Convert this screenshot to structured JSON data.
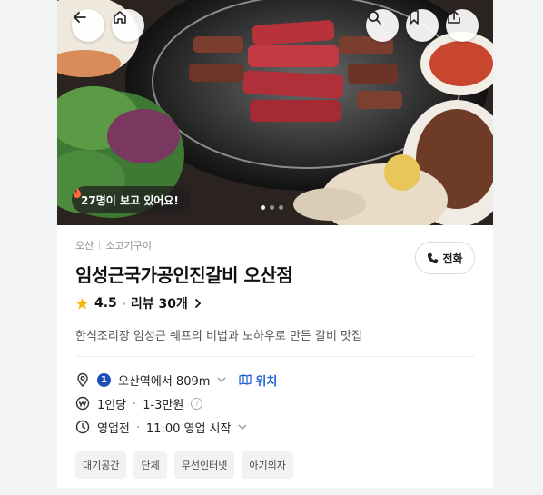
{
  "hero": {
    "viewer_badge": "27명이 보고 있어요!",
    "image_count": 3,
    "active_index": 0
  },
  "place": {
    "region": "오산",
    "category": "소고기구이",
    "name": "임성근국가공인진갈비 오산점",
    "rating": "4.5",
    "reviews": "리뷰 30개",
    "description": "한식조리장 임성근 쉐프의 비법과 노하우로 만든 갈비 맛집",
    "call_label": "전화"
  },
  "details": {
    "station_number": "1",
    "distance": "오산역에서 809m",
    "location_link": "위치",
    "price_per_person": "1인당",
    "price_range": "1-3만원",
    "status": "영업전",
    "hours": "11:00 영업 시작"
  },
  "tags": [
    "대기공간",
    "단체",
    "무선인터넷",
    "아기의자"
  ],
  "colors": {
    "accent_blue": "#1d5fd0",
    "station_badge": "#1b4fb6",
    "star": "#f5b800",
    "fire": "#ff6b3d"
  }
}
